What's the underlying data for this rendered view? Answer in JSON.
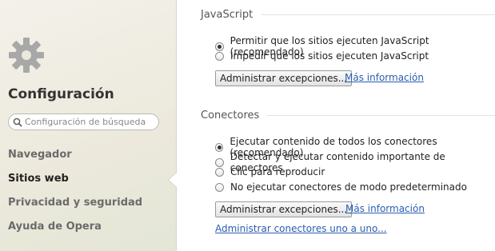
{
  "sidebar": {
    "title": "Configuración",
    "search_placeholder": "Configuración de búsqueda",
    "items": [
      {
        "label": "Navegador"
      },
      {
        "label": "Sitios web"
      },
      {
        "label": "Privacidad y seguridad"
      },
      {
        "label": "Ayuda de Opera"
      }
    ],
    "active_index": 1
  },
  "javascript": {
    "heading": "JavaScript",
    "options": [
      {
        "label": "Permitir que los sitios ejecuten JavaScript (recomendado)",
        "checked": true
      },
      {
        "label": "Impedir que los sitios ejecuten JavaScript",
        "checked": false
      }
    ],
    "exceptions_button": "Administrar excepciones...",
    "more_info_link": "Más información"
  },
  "plugins": {
    "heading": "Conectores",
    "options": [
      {
        "label": "Ejecutar contenido de todos los conectores (recomendado)",
        "checked": true
      },
      {
        "label": "Detectar y ejecutar contenido importante de conectores",
        "checked": false
      },
      {
        "label": "Clic para reproducir",
        "checked": false
      },
      {
        "label": "No ejecutar conectores de modo predeterminado",
        "checked": false
      }
    ],
    "exceptions_button": "Administrar excepciones...",
    "more_info_link": "Más información",
    "manage_individually_link": "Administrar conectores uno a uno..."
  },
  "colors": {
    "link": "#2a5db0",
    "gear": "#a8a8a8"
  }
}
